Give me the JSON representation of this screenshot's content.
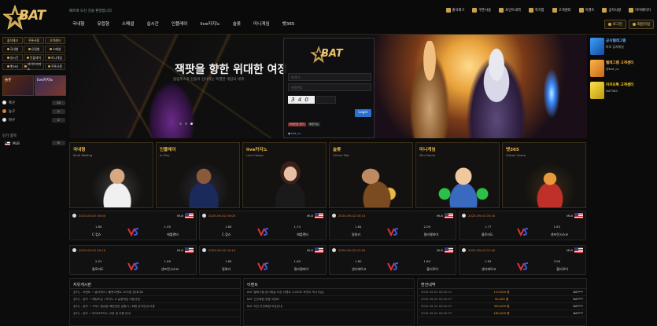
{
  "header": {
    "logo": "BAT",
    "notice": "배트에 오신 것을 환영합니다",
    "top_links": [
      "출석체크",
      "쿠폰사용",
      "포인트내역",
      "쪽지함",
      "고객센터",
      "이벤트",
      "공지사항",
      "마이페이지"
    ],
    "nav": [
      "국내형",
      "유럽형",
      "스페셜",
      "실시간",
      "인플레이",
      "live카지노",
      "슬롯",
      "미니게임",
      "벳365"
    ],
    "auth": [
      "로그인",
      "회원가입"
    ]
  },
  "left": {
    "top_buttons": [
      "출석체크",
      "쿠폰사용",
      "고객센터"
    ],
    "grid": [
      "국내형",
      "유럽형",
      "스페셜",
      "실시간",
      "인플레이",
      "미니게임",
      "벳365",
      "라이브카지노",
      "쿠폰사용"
    ],
    "promos": [
      "슬롯",
      "live카지노"
    ],
    "sports": [
      {
        "name": "축구",
        "count": "14"
      },
      {
        "name": "농구",
        "count": "0"
      },
      {
        "name": "야구",
        "count": "2"
      }
    ],
    "popular_title": "인기 종목",
    "popular": [
      {
        "name": "MLB",
        "count": "6"
      }
    ]
  },
  "banner": {
    "title": "잭팟을 향한 위대한 여정",
    "subtitle": "올림푸스의 신들이 선사하는 특별한 게임의 세계"
  },
  "login": {
    "logo": "BAT",
    "id_placeholder": "아이디",
    "pw_placeholder": "비밀번호",
    "captcha": "3 4 0 2",
    "login_btn": "Login",
    "small_buttons": [
      "비밀번호 찾기",
      "회원가입"
    ],
    "telegram": "bat_cs"
  },
  "right": [
    {
      "title": "공식텔레그램",
      "sub": "바로 공지채널",
      "color": "#6ab0ff"
    },
    {
      "title": "텔레그램 고객센터",
      "sub": "@bat_cs",
      "color": "#ffb347"
    },
    {
      "title": "카카오톡 고객센터",
      "sub": "BAT365",
      "color": "#ffd21a"
    }
  ],
  "cards": [
    {
      "name": "국내형",
      "en": "Multi Betting"
    },
    {
      "name": "인플레이",
      "en": "In Play"
    },
    {
      "name": "live카지노",
      "en": "Live Casino"
    },
    {
      "name": "슬롯",
      "en": "Online Slot"
    },
    {
      "name": "미니게임",
      "en": "Mini Game"
    },
    {
      "name": "벳365",
      "en": "Virtual Game"
    }
  ],
  "matches": [
    {
      "time": "2025-09-02 05:05",
      "league": "MLB",
      "odd1": "1.80",
      "odd2": "1.95",
      "team1": "C.컵스",
      "team2": "애틀랜타"
    },
    {
      "time": "2025-09-02 05:05",
      "league": "MLB",
      "odd1": "1.80",
      "odd2": "1.74",
      "team1": "C.컵스",
      "team2": "애틀랜타"
    },
    {
      "time": "2025-09-02 05:10",
      "league": "MLB",
      "odd1": "1.64",
      "odd2": "2.09",
      "team1": "밀워키",
      "team2": "필라델피아"
    },
    {
      "time": "2025-09-02 05:10",
      "league": "MLB",
      "odd1": "1.77",
      "odd2": "1.83",
      "team1": "콜로라도",
      "team2": "샌프란시스코"
    },
    {
      "time": "2025-09-02 05:10",
      "league": "MLB",
      "odd1": "2.01",
      "odd2": "1.69",
      "team1": "콜로라도",
      "team2": "샌프란시스코"
    },
    {
      "time": "2025-09-02 05:10",
      "league": "MLB",
      "odd1": "1.80",
      "odd2": "1.80",
      "team1": "밀워키",
      "team2": "필라델피아"
    },
    {
      "time": "2025-09-02 07:40",
      "league": "MLB",
      "odd1": "1.80",
      "odd2": "1.80",
      "team1": "샌디에이고",
      "team2": "볼티모어"
    },
    {
      "time": "2025-09-02 07:40",
      "league": "MLB",
      "odd1": "1.63",
      "odd2": "3.08",
      "team1": "샌디에이고",
      "team2": "볼티모어"
    }
  ],
  "bottom": {
    "notice_title": "자유게시판",
    "notice_rows": [
      "공지) - 이벤트 → 출석체크 / 룰렛이벤트 20%팀 업데이트",
      "공지) - 공지 → 해킹조심 / 카지노 & 슬롯게임 이용규정",
      "공지) - 공지 → 구매 / 환급형 베팅관련 설명서 / 회원 공지안내 이용",
      "공지) - 공지 → 라이브카지노 규정 및 이용 안내"
    ],
    "event_title": "이벤트",
    "event_rows": [
      "BAT 텔레그램 공식채널 오픈 이벤트 (10000 포인트 즉시지급)",
      "BAT 신규회원 첫충 이벤트",
      "BAT 지인 추천회원 보상안내"
    ],
    "payout_title": "환전내역",
    "payout_rows": [
      {
        "date": "2025-09-02 05:02:21",
        "amount": "110,000 원",
        "user": "BAT***"
      },
      {
        "date": "2025-09-02 05:02:07",
        "amount": "50,000 원",
        "user": "BAT***"
      },
      {
        "date": "2025-09-02 05:02:07",
        "amount": "300,000 원",
        "user": "BAT***"
      },
      {
        "date": "2025-09-02 05:02:07",
        "amount": "160,000 원",
        "user": "BAT***"
      }
    ]
  }
}
